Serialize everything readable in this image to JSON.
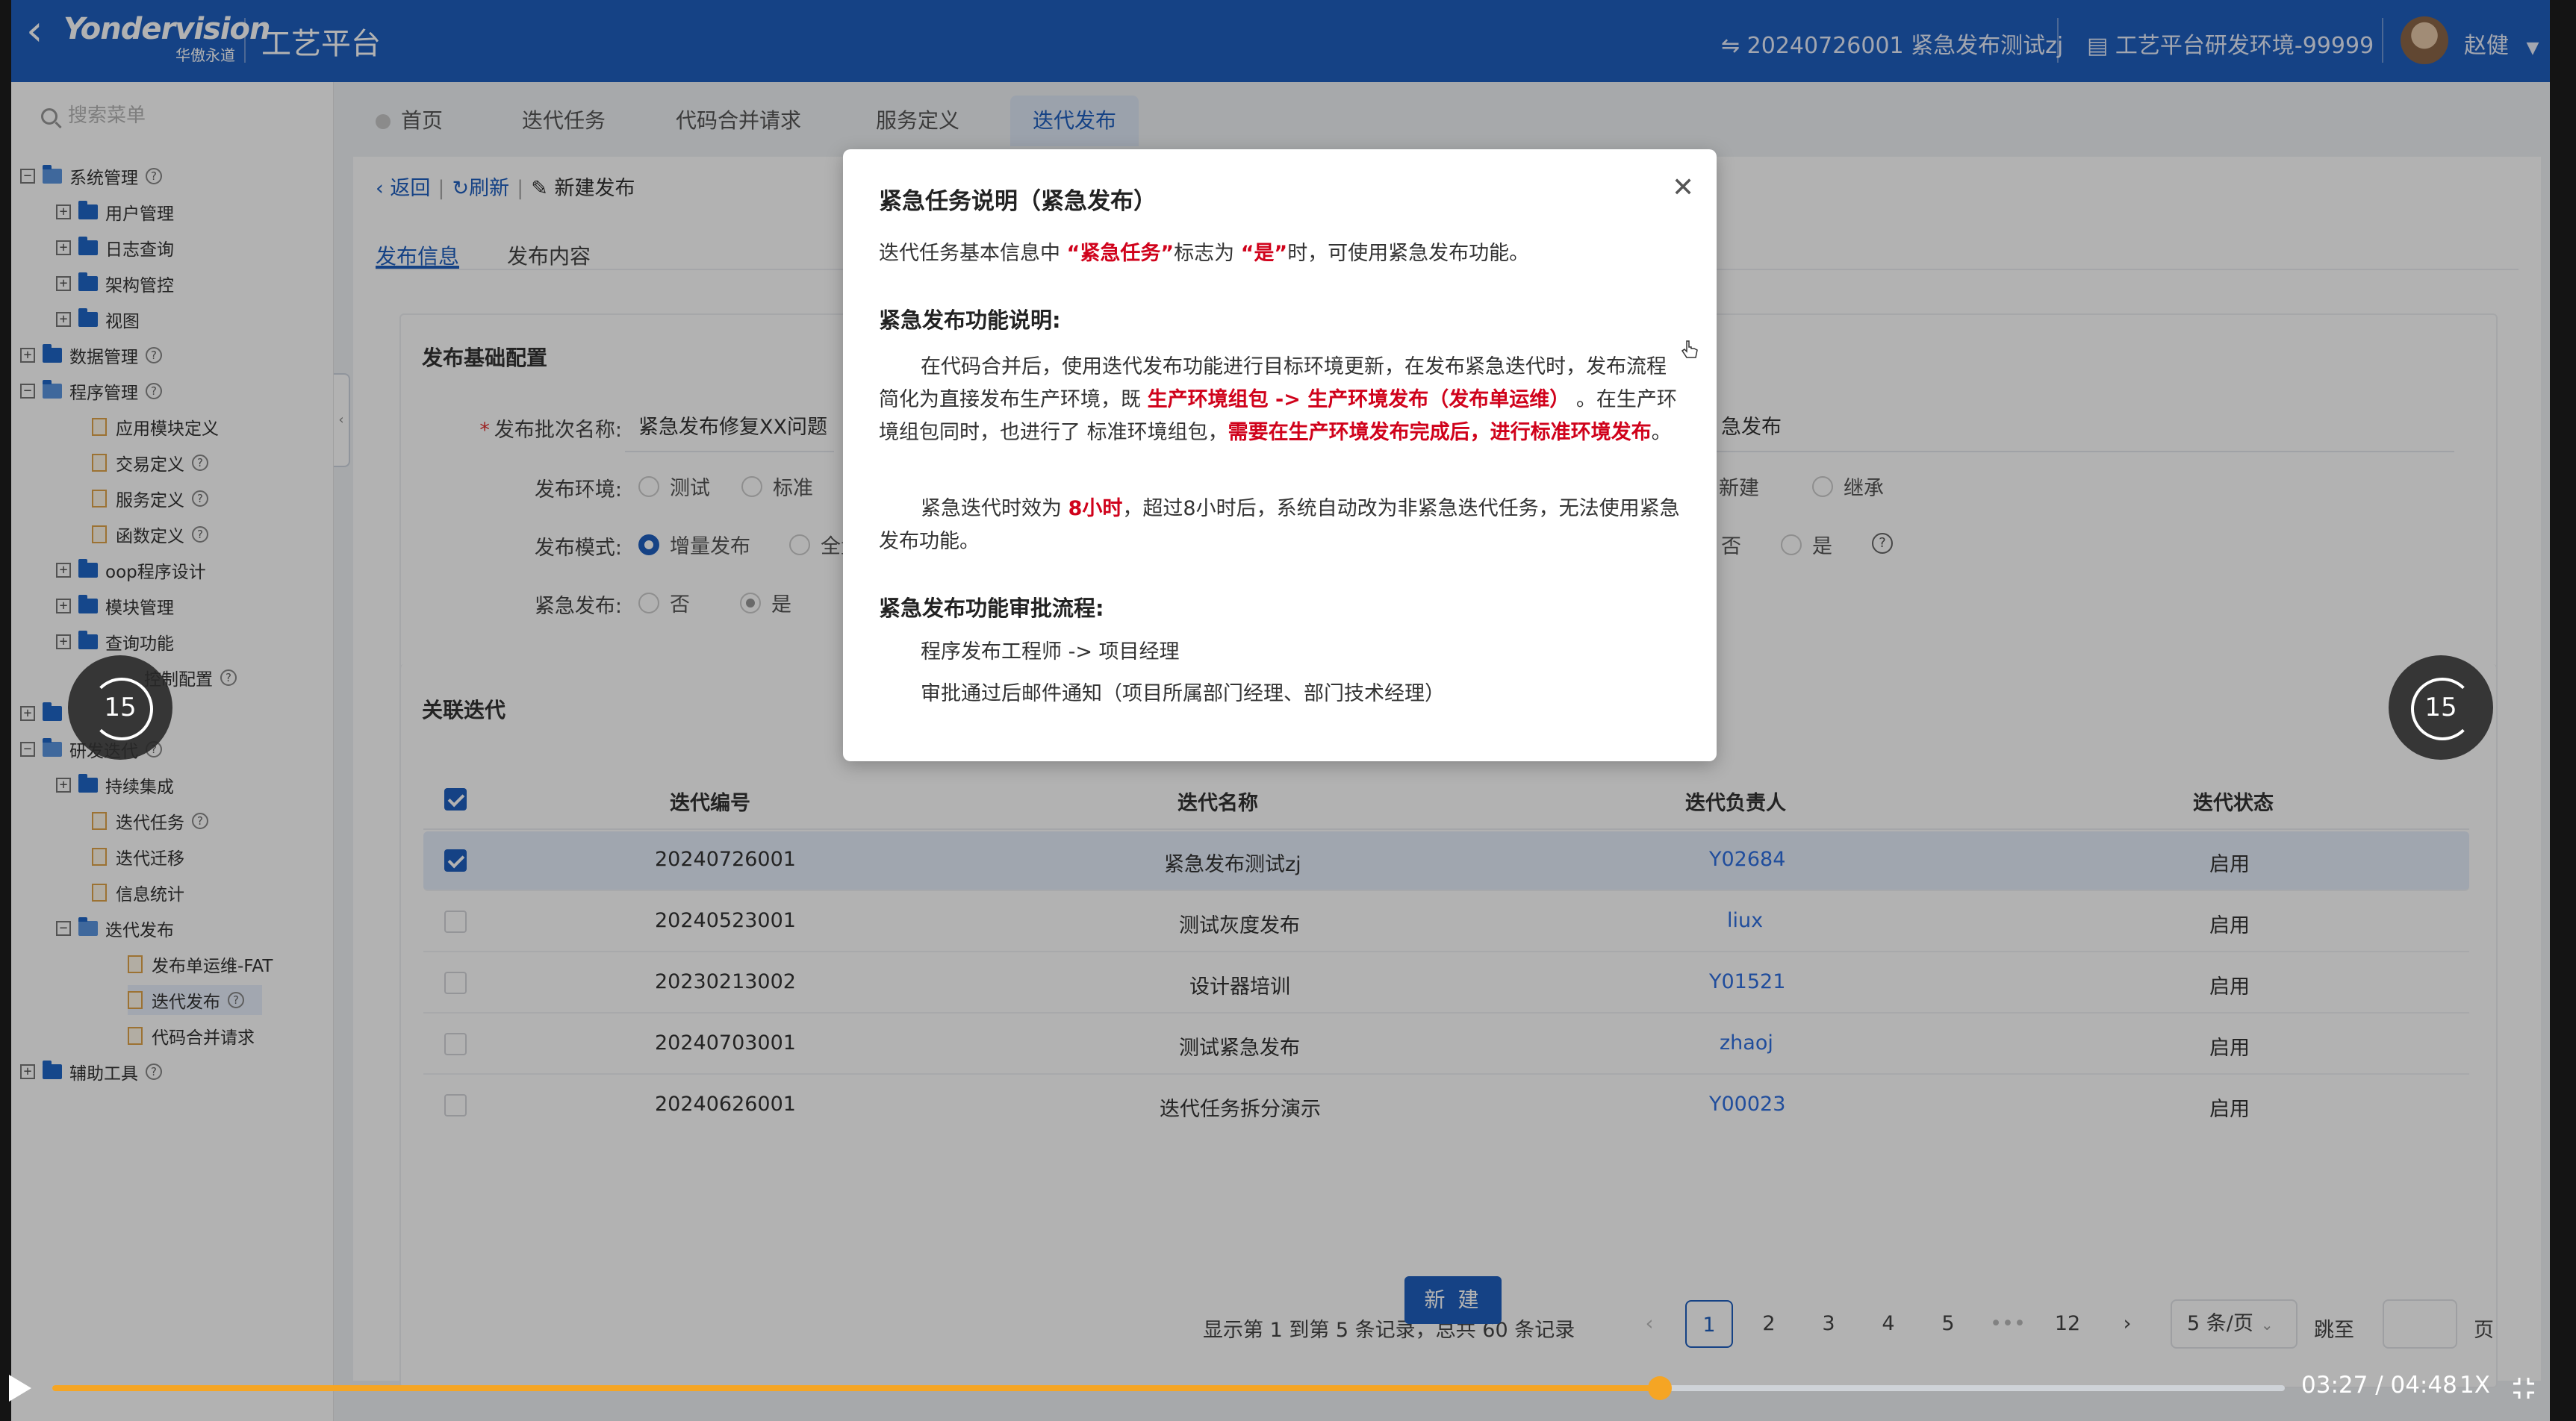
{
  "header": {
    "logo_line1": "Yondervision",
    "logo_line2": "华傲永道",
    "platform_title": "工艺平台",
    "iteration": "⇋ 20240726001 紧急发布测试zj",
    "environment": "工艺平台研发环境-99999",
    "user": "赵健"
  },
  "sidebar": {
    "search_placeholder": "搜索菜单",
    "items": [
      {
        "label": "系统管理"
      },
      {
        "label": "用户管理"
      },
      {
        "label": "日志查询"
      },
      {
        "label": "架构管控"
      },
      {
        "label": "视图"
      },
      {
        "label": "数据管理"
      },
      {
        "label": "程序管理"
      },
      {
        "label": "应用模块定义"
      },
      {
        "label": "交易定义"
      },
      {
        "label": "服务定义"
      },
      {
        "label": "函数定义"
      },
      {
        "label": "oop程序设计"
      },
      {
        "label": "模块管理"
      },
      {
        "label": "查询功能"
      },
      {
        "label": "控制配置"
      },
      {
        "label": "研发迭代"
      },
      {
        "label": "持续集成"
      },
      {
        "label": "迭代任务"
      },
      {
        "label": "迭代迁移"
      },
      {
        "label": "信息统计"
      },
      {
        "label": "迭代发布"
      },
      {
        "label": "发布单运维-FAT"
      },
      {
        "label": "迭代发布"
      },
      {
        "label": "代码合并请求"
      },
      {
        "label": "辅助工具"
      }
    ]
  },
  "tabs": [
    "首页",
    "迭代任务",
    "代码合并请求",
    "服务定义",
    "迭代发布"
  ],
  "toolbar": {
    "back": "返回",
    "refresh": "刷新",
    "current": "新建发布"
  },
  "subtabs": [
    "发布信息",
    "发布内容"
  ],
  "form": {
    "section_title": "发布基础配置",
    "batch_name_label": "发布批次名称:",
    "batch_name_value": "紧急发布修复XX问题",
    "batch_name_right": "急发布",
    "env_label": "发布环境:",
    "env_options": [
      "测试",
      "标准"
    ],
    "env_right": [
      "新建",
      "继承"
    ],
    "mode_label": "发布模式:",
    "mode_options": [
      "增量发布",
      "全量"
    ],
    "mode_right_fragment": "否",
    "mode_right_yes": "是",
    "urgent_label": "紧急发布:",
    "urgent_options": [
      "否",
      "是"
    ]
  },
  "table": {
    "section_title": "关联迭代",
    "columns": [
      "迭代编号",
      "迭代名称",
      "迭代负责人",
      "迭代状态"
    ],
    "rows": [
      {
        "id": "20240726001",
        "name": "紧急发布测试zj",
        "owner": "Y02684",
        "status": "启用"
      },
      {
        "id": "20240523001",
        "name": "测试灰度发布",
        "owner": "liux",
        "status": "启用"
      },
      {
        "id": "20230213002",
        "name": "设计器培训",
        "owner": "Y01521",
        "status": "启用"
      },
      {
        "id": "20240703001",
        "name": "测试紧急发布",
        "owner": "zhaoj",
        "status": "启用"
      },
      {
        "id": "20240626001",
        "name": "迭代任务拆分演示",
        "owner": "Y00023",
        "status": "启用"
      }
    ],
    "selected_row_index": 0
  },
  "pagination": {
    "summary": "显示第 1 到第 5 条记录，总共 60 条记录",
    "pages": [
      "1",
      "2",
      "3",
      "4",
      "5",
      "•••",
      "12"
    ],
    "current_page": "1",
    "page_size": "5 条/页",
    "jump_label": "跳至",
    "page_unit": "页"
  },
  "new_button": "新 建",
  "modal": {
    "title": "紧急任务说明（紧急发布）",
    "intro_pre": "迭代任务基本信息中 ",
    "intro_flag": "“紧急任务”",
    "intro_mid": "标志为 ",
    "intro_yes": "“是”",
    "intro_post": "时，可使用紧急发布功能。",
    "func_heading": "紧急发布功能说明:",
    "para1_a": "在代码合并后，使用迭代发布功能进行目标环境更新，在发布紧急迭代时，发布流程简化为直接发布生产环境，既 ",
    "para1_red1": "生产环境组包 -> 生产环境发布（发布单运维）",
    "para1_b": " 。在生产环境组包同时，也进行了 标准环境组包，",
    "para1_red2": "需要在生产环境发布完成后，进行标准环境发布",
    "para1_c": "。",
    "para2_a": "紧急迭代时效为 ",
    "para2_red": "8小时",
    "para2_b": "，超过8小时后，系统自动改为非紧急迭代任务，无法使用紧急发布功能。",
    "approval_heading": "紧急发布功能审批流程:",
    "approval_line1": "程序发布工程师 -> 项目经理",
    "approval_line2": "审批通过后邮件通知（项目所属部门经理、部门技术经理）"
  },
  "video": {
    "skip_back": "15",
    "skip_forward": "15",
    "time": "03:27 / 04:48",
    "speed": "1X",
    "progress_fraction": 0.72
  },
  "colors": {
    "brand": "#1f5fbf",
    "accent": "#f5a524",
    "danger": "#d0021b"
  }
}
